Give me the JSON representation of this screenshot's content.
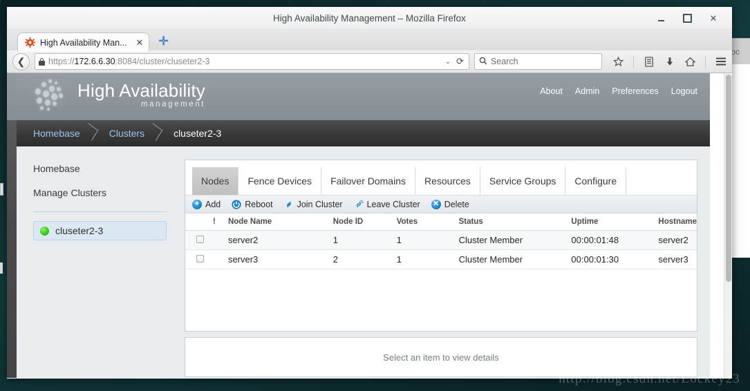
{
  "window": {
    "title": "High Availability Management – Mozilla Firefox",
    "minimize_label": "_",
    "maximize_label": "□",
    "close_label": "✕"
  },
  "browser": {
    "tab": {
      "title": "High Availability Man...",
      "favicon": "gear-icon",
      "close_label": "✕"
    },
    "new_tab_label": "✛",
    "back_label": "❮",
    "url_host": "172.6.6.30",
    "url_prefix": "https://",
    "url_suffix": ":8084/cluster/cluseter2-3",
    "url_dropdown_label": "⌄",
    "reload_label": "⟳",
    "search_placeholder": "Search",
    "search_glyph": "🔍",
    "toolbar_icons": [
      {
        "name": "bookmark-star-icon",
        "glyph": "☆"
      },
      {
        "name": "library-icon",
        "glyph": "▤"
      },
      {
        "name": "downloads-icon",
        "glyph": "⬇"
      },
      {
        "name": "home-icon",
        "glyph": "⌂"
      },
      {
        "name": "menu-hamburger-icon",
        "glyph": "☰"
      }
    ]
  },
  "app": {
    "brand_line1": "High Availability",
    "brand_line2": "management",
    "header_links": [
      "About",
      "Admin",
      "Preferences",
      "Logout"
    ],
    "breadcrumb": [
      {
        "label": "Homebase",
        "current": false
      },
      {
        "label": "Clusters",
        "current": false
      },
      {
        "label": "cluseter2-3",
        "current": true
      }
    ],
    "sidebar": {
      "links": [
        "Homebase",
        "Manage Clusters"
      ],
      "clusters": [
        {
          "name": "cluseter2-3",
          "status_color": "#3fc91a",
          "selected": true
        }
      ]
    },
    "tabs": [
      {
        "label": "Nodes",
        "active": true
      },
      {
        "label": "Fence Devices",
        "active": false
      },
      {
        "label": "Failover Domains",
        "active": false
      },
      {
        "label": "Resources",
        "active": false
      },
      {
        "label": "Service Groups",
        "active": false
      },
      {
        "label": "Configure",
        "active": false
      }
    ],
    "toolbar": [
      {
        "label": "Add",
        "icon": "plus-circle-icon"
      },
      {
        "label": "Reboot",
        "icon": "power-gear-icon"
      },
      {
        "label": "Join Cluster",
        "icon": "link-icon"
      },
      {
        "label": "Leave Cluster",
        "icon": "broken-link-icon"
      },
      {
        "label": "Delete",
        "icon": "x-circle-icon"
      }
    ],
    "table": {
      "columns": [
        "",
        "!",
        "Node Name",
        "Node ID",
        "Votes",
        "Status",
        "Uptime",
        "Hostname"
      ],
      "rows": [
        {
          "node_name": "server2",
          "node_id": "1",
          "votes": "1",
          "status": "Cluster Member",
          "uptime": "00:00:01:48",
          "hostname": "server2"
        },
        {
          "node_name": "server3",
          "node_id": "2",
          "votes": "1",
          "status": "Cluster Member",
          "uptime": "00:00:01:30",
          "hostname": "server3"
        }
      ]
    },
    "detail_placeholder": "Select an item to view details"
  },
  "background_window": {
    "fragment_text": "⟩loc"
  },
  "watermark": "http://blog.csdn.net/Lockey23"
}
